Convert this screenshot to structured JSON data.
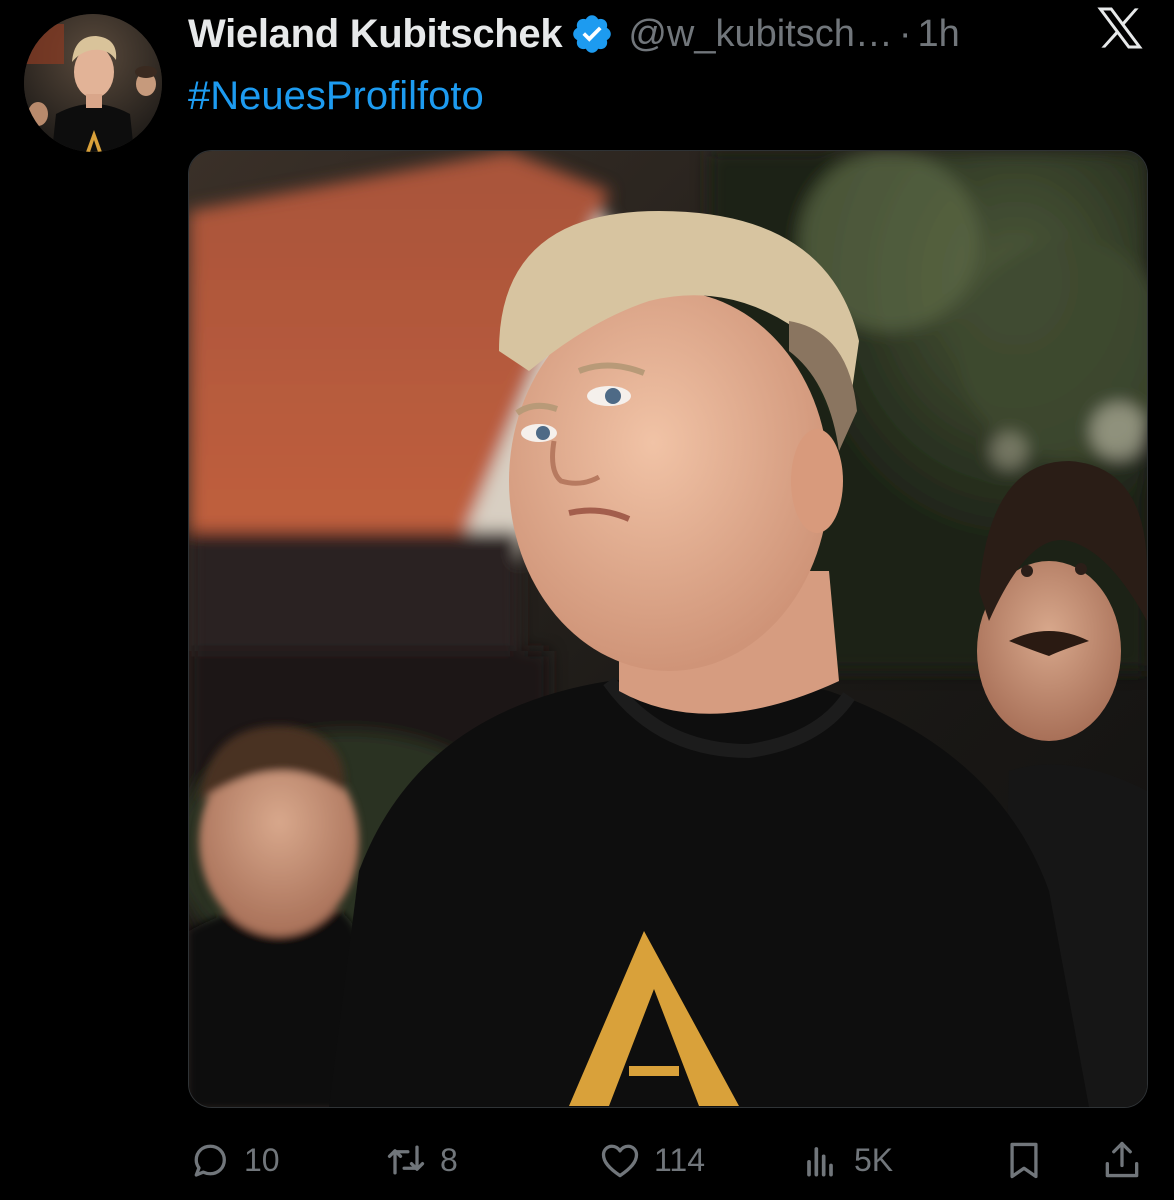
{
  "tweet": {
    "display_name": "Wieland Kubitschek",
    "handle": "@w_kubitsch…",
    "separator": "·",
    "timestamp": "1h",
    "text": "#NeuesProfilfoto"
  },
  "icons": {
    "verified": "verified-badge-icon",
    "brand": "x-logo-icon",
    "reply": "reply-icon",
    "retweet": "retweet-icon",
    "like": "heart-icon",
    "views": "views-icon",
    "bookmark": "bookmark-icon",
    "share": "share-icon"
  },
  "actions": {
    "replies": "10",
    "retweets": "8",
    "likes": "114",
    "views": "5K"
  },
  "colors": {
    "background": "#000000",
    "text_primary": "#e7e9ea",
    "text_secondary": "#71767b",
    "accent": "#1d9bf0"
  }
}
